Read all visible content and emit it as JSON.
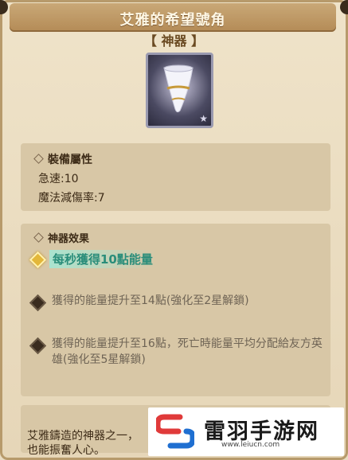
{
  "window": {
    "title": "艾雅的希望號角",
    "subtitle": "【 神器 】"
  },
  "item": {
    "icon": "horn-icon",
    "rarity_icon": "star-icon"
  },
  "stats": {
    "header": "裝備屬性",
    "lines": [
      "急速:10",
      "魔法減傷率:7"
    ]
  },
  "effects": {
    "header": "神器效果",
    "items": [
      {
        "text": "每秒獲得10點能量",
        "active": true
      },
      {
        "text": "獲得的能量提升至14點(強化至2星解鎖)",
        "active": false
      },
      {
        "text": "獲得的能量提升至16點，死亡時能量平均分配給友方英雄(強化至5星解鎖)",
        "active": false
      }
    ]
  },
  "lore": {
    "lines": [
      "艾雅鑄造的神器之一，",
      "也能振奮人心。"
    ]
  },
  "watermark": {
    "brand": "雷羽手游网",
    "url": "www.leiucn.com"
  },
  "colors": {
    "active_effect": "#2a8d7a",
    "title_bar": "#b48b56",
    "panel": "#d8c7a6"
  }
}
